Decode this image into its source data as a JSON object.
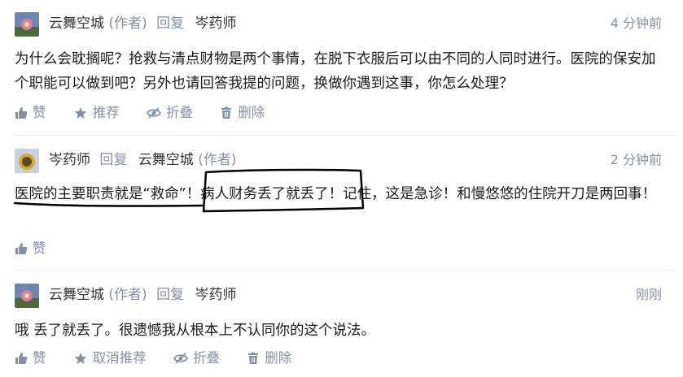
{
  "comments": [
    {
      "user": "云舞空城",
      "author_tag": "(作者)",
      "reply_label": "回复",
      "reply_to": "岑药师",
      "time": "4 分钟前",
      "text": "为什么会耽搁呢？抢救与清点财物是两个事情，在脱下衣服后可以由不同的人同时进行。医院的保安加个职能可以做到吧？另外也请回答我提的问题，换做你遇到这事，你怎么处理？",
      "actions": [
        "赞",
        "推荐",
        "折叠",
        "删除"
      ]
    },
    {
      "user": "岑药师",
      "reply_label": "回复",
      "reply_to": "云舞空城",
      "reply_to_tag": "(作者)",
      "time": "2 分钟前",
      "text": "医院的主要职责就是“救命”！病人财务丢了就丢了！记住，这是急诊！和慢悠悠的住院开刀是两回事！",
      "actions": [
        "赞"
      ]
    },
    {
      "user": "云舞空城",
      "author_tag": "(作者)",
      "reply_label": "回复",
      "reply_to": "岑药师",
      "time": "刚刚",
      "text": "哦 丢了就丢了。很遗憾我从根本上不认同你的这个说法。",
      "actions": [
        "赞",
        "取消推荐",
        "折叠",
        "删除"
      ]
    }
  ],
  "icons": {
    "like": "thumbs-up-icon",
    "recommend": "star-icon",
    "fold": "eye-slash-icon",
    "delete": "trash-icon"
  },
  "colors": {
    "meta": "#8590a6",
    "text": "#1a1a1a",
    "annotation": "#000000"
  }
}
